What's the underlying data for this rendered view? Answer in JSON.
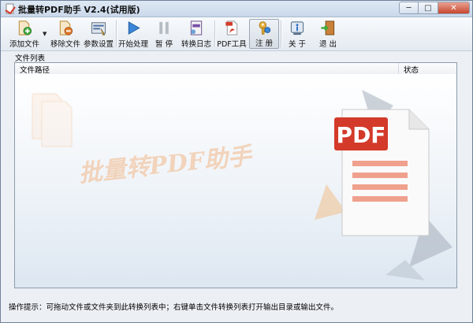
{
  "window": {
    "title": "批量转PDF助手 V2.4(试用版)",
    "controls": {
      "minimize": "─",
      "maximize": "□",
      "close": "✕"
    }
  },
  "toolbar": {
    "items": [
      {
        "id": "add-file",
        "label": "添加文件",
        "icon": "add-file-icon"
      },
      {
        "id": "remove-file",
        "label": "移除文件",
        "icon": "remove-file-icon"
      },
      {
        "id": "settings",
        "label": "参数设置",
        "icon": "settings-icon"
      },
      {
        "id": "start",
        "label": "开始处理",
        "icon": "play-icon"
      },
      {
        "id": "pause",
        "label": "暂 停",
        "icon": "pause-icon"
      },
      {
        "id": "log",
        "label": "转换日志",
        "icon": "log-icon"
      },
      {
        "id": "pdf-tools",
        "label": "PDF工具",
        "icon": "pdf-tools-icon"
      },
      {
        "id": "register",
        "label": "注 册",
        "icon": "key-icon"
      },
      {
        "id": "about",
        "label": "关 于",
        "icon": "info-icon"
      },
      {
        "id": "exit",
        "label": "退 出",
        "icon": "exit-door-icon"
      }
    ],
    "dropdown_arrow": "▼"
  },
  "filelist": {
    "group_label": "文件列表",
    "columns": [
      "文件路径",
      "状态"
    ],
    "watermark_text": "批量转PDF助手",
    "watermark_badge": "PDF"
  },
  "status": {
    "hint": "操作提示：可拖动文件或文件夹到此转换列表中；右键单击文件转换列表打开输出目录或输出文件。"
  },
  "colors": {
    "accent": "#2f6fc4",
    "pdf_red": "#d33a2a",
    "recycle_gray": "#9aa6b2",
    "watermark_orange": "#f2b27a"
  }
}
